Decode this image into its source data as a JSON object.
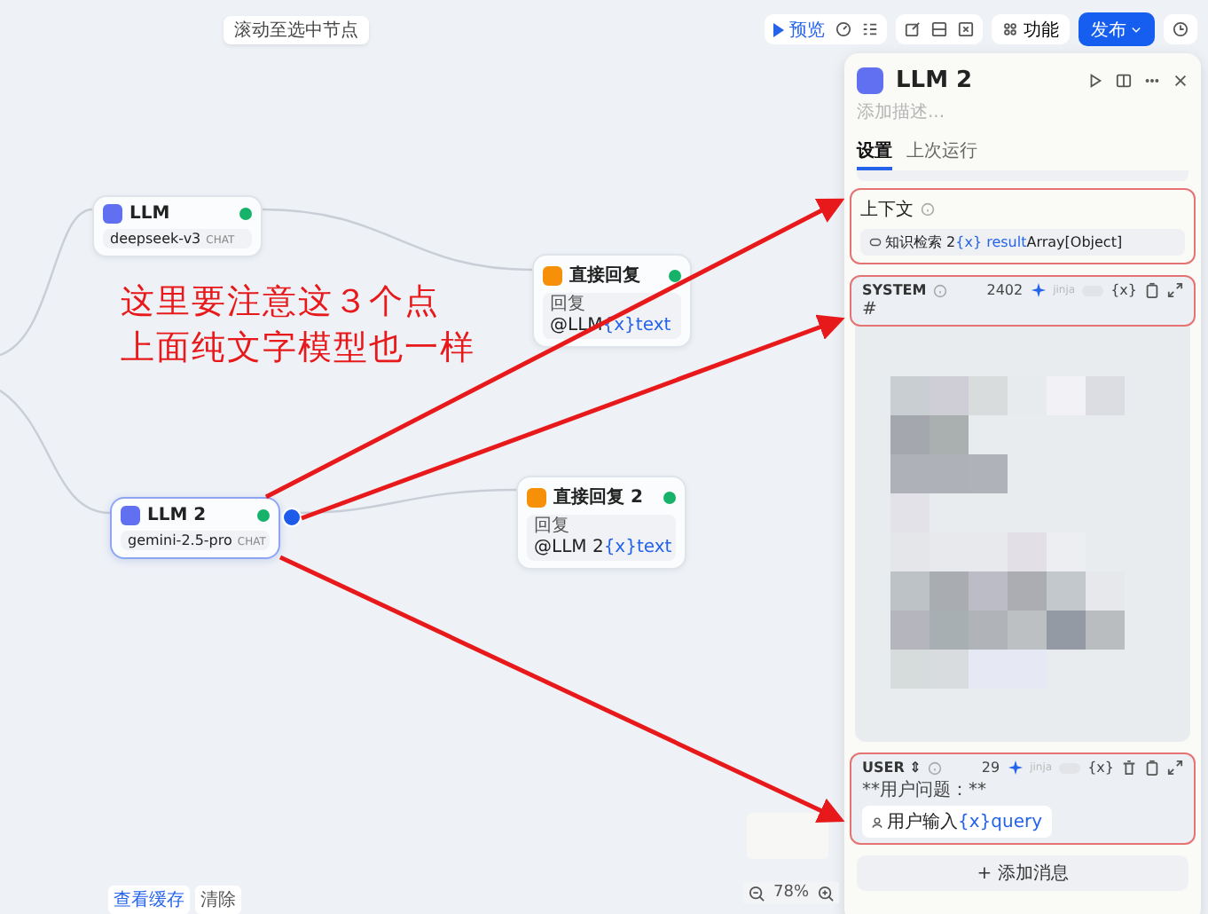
{
  "canvas_hint": "滚动至选中节点",
  "toolbar": {
    "preview": "预览",
    "features": "功能",
    "publish": "发布"
  },
  "nodes": [
    {
      "kind": "llm",
      "title": "LLM",
      "model": "deepseek-v3",
      "tag": "CHAT",
      "selected": false
    },
    {
      "kind": "answer",
      "title": "直接回复",
      "label": "回复",
      "ref_node": "@LLM",
      "ref_var": "{x}text"
    },
    {
      "kind": "llm",
      "title": "LLM 2",
      "model": "gemini-2.5-pro",
      "tag": "CHAT",
      "selected": true
    },
    {
      "kind": "answer",
      "title": "直接回复 2",
      "label": "回复",
      "ref_node": "@LLM 2",
      "ref_var": "{x}text"
    }
  ],
  "annotation": {
    "lines": [
      "这里要注意这３个点",
      "上面纯文字模型也一样"
    ]
  },
  "panel": {
    "title": "LLM 2",
    "description_placeholder": "添加描述...",
    "tabs": [
      {
        "label": "设置",
        "selected": true
      },
      {
        "label": "上次运行",
        "selected": false
      }
    ],
    "context": {
      "label": "上下文",
      "highlighted": true,
      "source": "知识检索 2",
      "var": "{x} result",
      "type": "Array[Object]"
    },
    "messages": [
      {
        "kind": "system",
        "role": "SYSTEM",
        "count": "2402",
        "jinja": "jinja",
        "on": false,
        "highlighted": true,
        "var_button": "{x}",
        "lines": [
          "#"
        ]
      },
      {
        "kind": "user",
        "role": "USER ⇕",
        "count": "29",
        "jinja": "jinja",
        "on": false,
        "highlighted": true,
        "var_button": "{x}",
        "lines": [
          "**用户问题：**"
        ],
        "ref_node": "用户输入",
        "ref_var": "{x}query"
      }
    ],
    "add_message": "+ 添加消息"
  },
  "footer": {
    "cache": "查看缓存",
    "clear": "清除",
    "zoom": "78%"
  }
}
